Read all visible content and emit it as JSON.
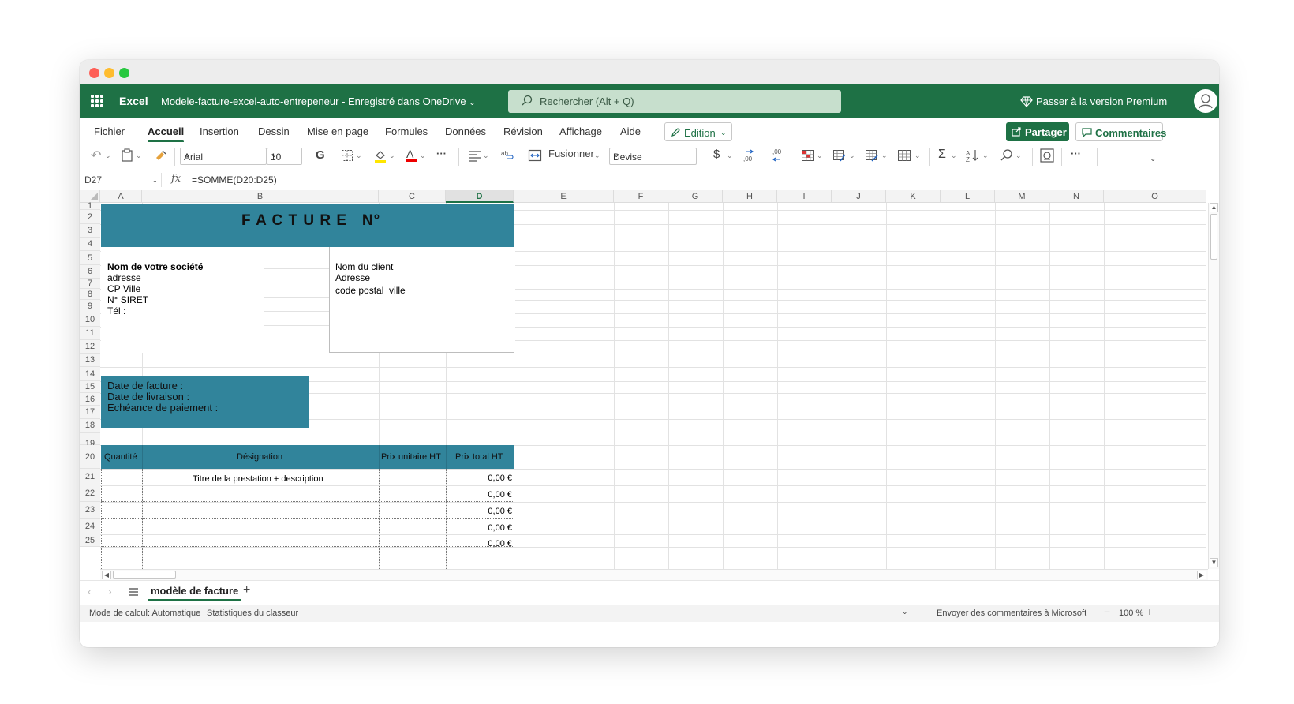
{
  "app": {
    "name": "Excel",
    "document": "Modele-facture-excel-auto-entrepeneur  -  Enregistré dans OneDrive",
    "search_placeholder": "Rechercher (Alt + Q)",
    "premium": "Passer à la version Premium"
  },
  "menu": {
    "tabs": [
      "Fichier",
      "Accueil",
      "Insertion",
      "Dessin",
      "Mise en page",
      "Formules",
      "Données",
      "Révision",
      "Affichage",
      "Aide"
    ],
    "active": "Accueil",
    "edition": "Edition",
    "share": "Partager",
    "comments": "Commentaires"
  },
  "toolbar": {
    "font": "Arial",
    "size": "10",
    "bold": "G",
    "merge": "Fusionner",
    "number_format": "Devise",
    "more": "···"
  },
  "formula_bar": {
    "cell": "D27",
    "fx": "fx",
    "formula": "=SOMME(D20:D25)"
  },
  "columns": [
    "A",
    "B",
    "C",
    "D",
    "E",
    "F",
    "G",
    "H",
    "I",
    "J",
    "K",
    "L",
    "M",
    "N",
    "O"
  ],
  "selected_column": "D",
  "rows": [
    "1",
    "2",
    "3",
    "4",
    "5",
    "6",
    "7",
    "8",
    "9",
    "10",
    "11",
    "12",
    "13",
    "14",
    "15",
    "16",
    "17",
    "18",
    "19",
    "20",
    "21",
    "22",
    "23",
    "24",
    "25"
  ],
  "invoice": {
    "title": "F A C T U R E   N°",
    "company": {
      "name": "Nom de votre société",
      "address": "adresse",
      "city": "CP Ville",
      "siret": "N° SIRET",
      "phone": "Tél :"
    },
    "client": {
      "name": "Nom du client",
      "address": "Adresse",
      "city": "code postal  ville"
    },
    "dates": {
      "invoice_date": "Date de facture :",
      "delivery_date": "Date de livraison :",
      "due": "Echéance de paiement :"
    },
    "table": {
      "headers": [
        "Quantité",
        "Désignation",
        "Prix unitaire HT",
        "Prix total HT"
      ],
      "first_designation": "Titre de la prestation + description",
      "totals": [
        "0,00 €",
        "0,00 €",
        "0,00 €",
        "0,00 €",
        "0,00 €"
      ]
    }
  },
  "sheet_tabs": {
    "active": "modèle de facture",
    "add": "+"
  },
  "status": {
    "calc": "Mode de calcul: Automatique",
    "stats": "Statistiques du classeur",
    "feedback": "Envoyer des commentaires à Microsoft",
    "zoom": "100 %"
  },
  "colors": {
    "brand": "#1e7145",
    "header_band": "#31849b"
  }
}
